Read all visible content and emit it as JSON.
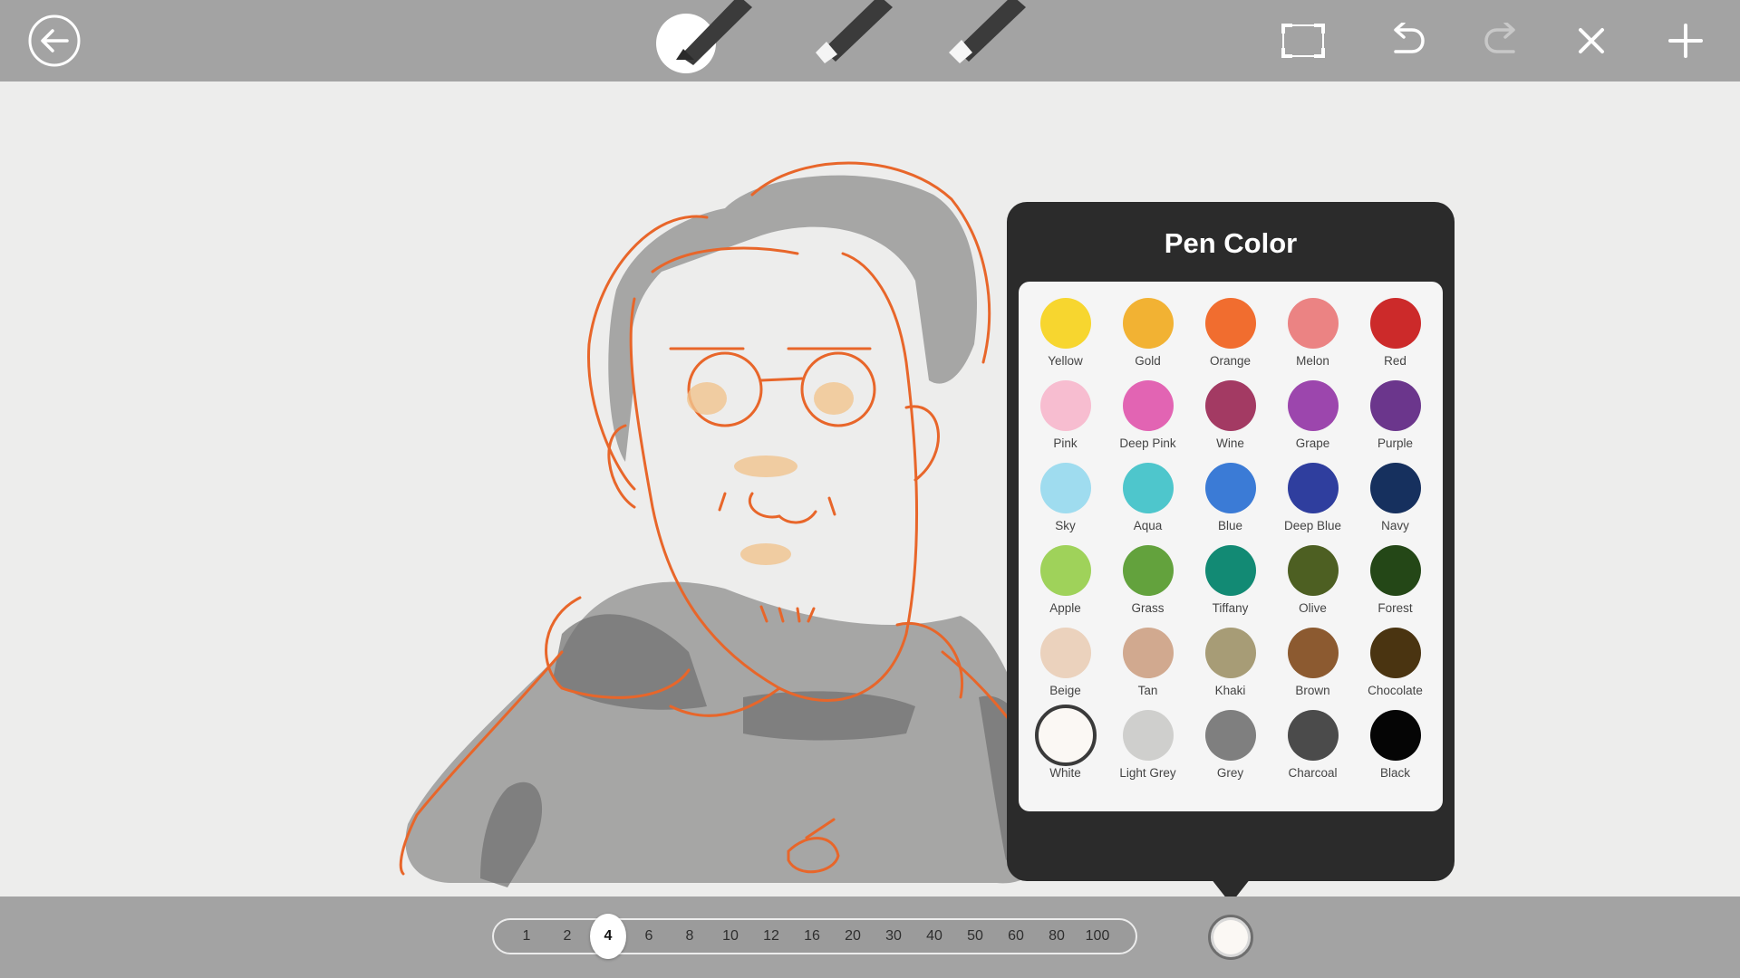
{
  "toolbar": {
    "back_icon": "back-arrow-icon",
    "tools": [
      {
        "name": "pen-brush",
        "icon": "brush-pen-icon"
      },
      {
        "name": "marker",
        "icon": "marker-pen-icon"
      },
      {
        "name": "eraser",
        "icon": "eraser-pen-icon"
      }
    ],
    "right_icons": [
      "fullscreen-icon",
      "undo-icon",
      "redo-icon",
      "close-icon",
      "add-icon"
    ]
  },
  "pen_color_popup": {
    "title": "Pen Color",
    "selected": "White",
    "colors": [
      {
        "name": "Yellow",
        "hex": "#f7d62f"
      },
      {
        "name": "Gold",
        "hex": "#f2b233"
      },
      {
        "name": "Orange",
        "hex": "#f16d2f"
      },
      {
        "name": "Melon",
        "hex": "#eb8383"
      },
      {
        "name": "Red",
        "hex": "#cc2a2a"
      },
      {
        "name": "Pink",
        "hex": "#f7bdd0"
      },
      {
        "name": "Deep Pink",
        "hex": "#e264b3"
      },
      {
        "name": "Wine",
        "hex": "#a33a63"
      },
      {
        "name": "Grape",
        "hex": "#9c46ad"
      },
      {
        "name": "Purple",
        "hex": "#6b368c"
      },
      {
        "name": "Sky",
        "hex": "#9fdcef"
      },
      {
        "name": "Aqua",
        "hex": "#4ec6cc"
      },
      {
        "name": "Blue",
        "hex": "#3b7bd6"
      },
      {
        "name": "Deep Blue",
        "hex": "#2f3e9e"
      },
      {
        "name": "Navy",
        "hex": "#16305e"
      },
      {
        "name": "Apple",
        "hex": "#9fd25a"
      },
      {
        "name": "Grass",
        "hex": "#63a23d"
      },
      {
        "name": "Tiffany",
        "hex": "#128a74"
      },
      {
        "name": "Olive",
        "hex": "#4d5f22"
      },
      {
        "name": "Forest",
        "hex": "#244717"
      },
      {
        "name": "Beige",
        "hex": "#ebd2bd"
      },
      {
        "name": "Tan",
        "hex": "#d1a98f"
      },
      {
        "name": "Khaki",
        "hex": "#a79c76"
      },
      {
        "name": "Brown",
        "hex": "#8c5a30"
      },
      {
        "name": "Chocolate",
        "hex": "#4a3411"
      },
      {
        "name": "White",
        "hex": "#fbf8f4"
      },
      {
        "name": "Light Grey",
        "hex": "#cfcfcd"
      },
      {
        "name": "Grey",
        "hex": "#7f7f7f"
      },
      {
        "name": "Charcoal",
        "hex": "#4b4b4b"
      },
      {
        "name": "Black",
        "hex": "#050505"
      }
    ]
  },
  "size_bar": {
    "sizes": [
      "1",
      "2",
      "4",
      "6",
      "8",
      "10",
      "12",
      "16",
      "20",
      "30",
      "40",
      "50",
      "60",
      "80",
      "100"
    ],
    "selected": "4"
  },
  "current_color": {
    "name": "White",
    "hex": "#fbf8f4"
  }
}
